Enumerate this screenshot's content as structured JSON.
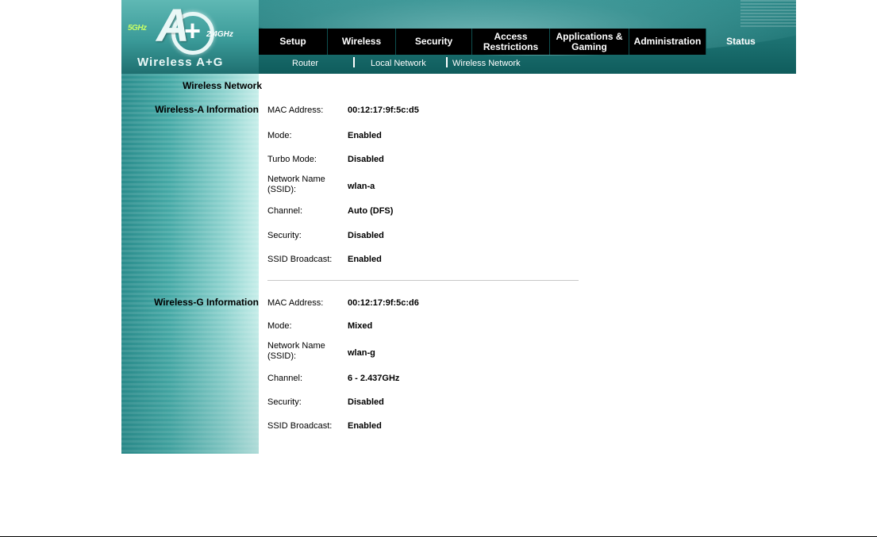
{
  "logo": {
    "band_5ghz": "5GHz",
    "band_24ghz": "2.4GHz",
    "big_letter": "A",
    "plus": "+",
    "wordmark": "Wireless A+G"
  },
  "tabs": [
    {
      "label": "Setup"
    },
    {
      "label": "Wireless"
    },
    {
      "label": "Security"
    },
    {
      "label": "Access Restrictions"
    },
    {
      "label": "Applications & Gaming"
    },
    {
      "label": "Administration"
    },
    {
      "label": "Status"
    }
  ],
  "active_tab": "Status",
  "subnav": [
    {
      "label": "Router"
    },
    {
      "label": "Local Network"
    },
    {
      "label": "Wireless Network"
    }
  ],
  "active_subnav": "Wireless Network",
  "page_title": "Wireless Network",
  "wireless_a": {
    "section_label": "Wireless-A Information",
    "mac_label": "MAC Address:",
    "mac_value": "00:12:17:9f:5c:d5",
    "mode_label": "Mode:",
    "mode_value": "Enabled",
    "turbo_label": "Turbo Mode:",
    "turbo_value": "Disabled",
    "ssid_label_line1": "Network Name",
    "ssid_label_line2": "(SSID):",
    "ssid_value": "wlan-a",
    "channel_label": "Channel:",
    "channel_value": "Auto (DFS)",
    "security_label": "Security:",
    "security_value": "Disabled",
    "broadcast_label": "SSID Broadcast:",
    "broadcast_value": "Enabled"
  },
  "wireless_g": {
    "section_label": "Wireless-G Information",
    "mac_label": "MAC Address:",
    "mac_value": "00:12:17:9f:5c:d6",
    "mode_label": "Mode:",
    "mode_value": "Mixed",
    "ssid_label_line1": "Network Name",
    "ssid_label_line2": "(SSID):",
    "ssid_value": "wlan-g",
    "channel_label": "Channel:",
    "channel_value": "6 - 2.437GHz",
    "security_label": "Security:",
    "security_value": "Disabled",
    "broadcast_label": "SSID Broadcast:",
    "broadcast_value": "Enabled"
  },
  "colors": {
    "header_teal": "#1f7676",
    "tab_background": "#000000",
    "tab_text": "#ffffff",
    "sidebar_gradient_start": "#2a8c8c",
    "sidebar_gradient_end": "#c7eeea"
  }
}
